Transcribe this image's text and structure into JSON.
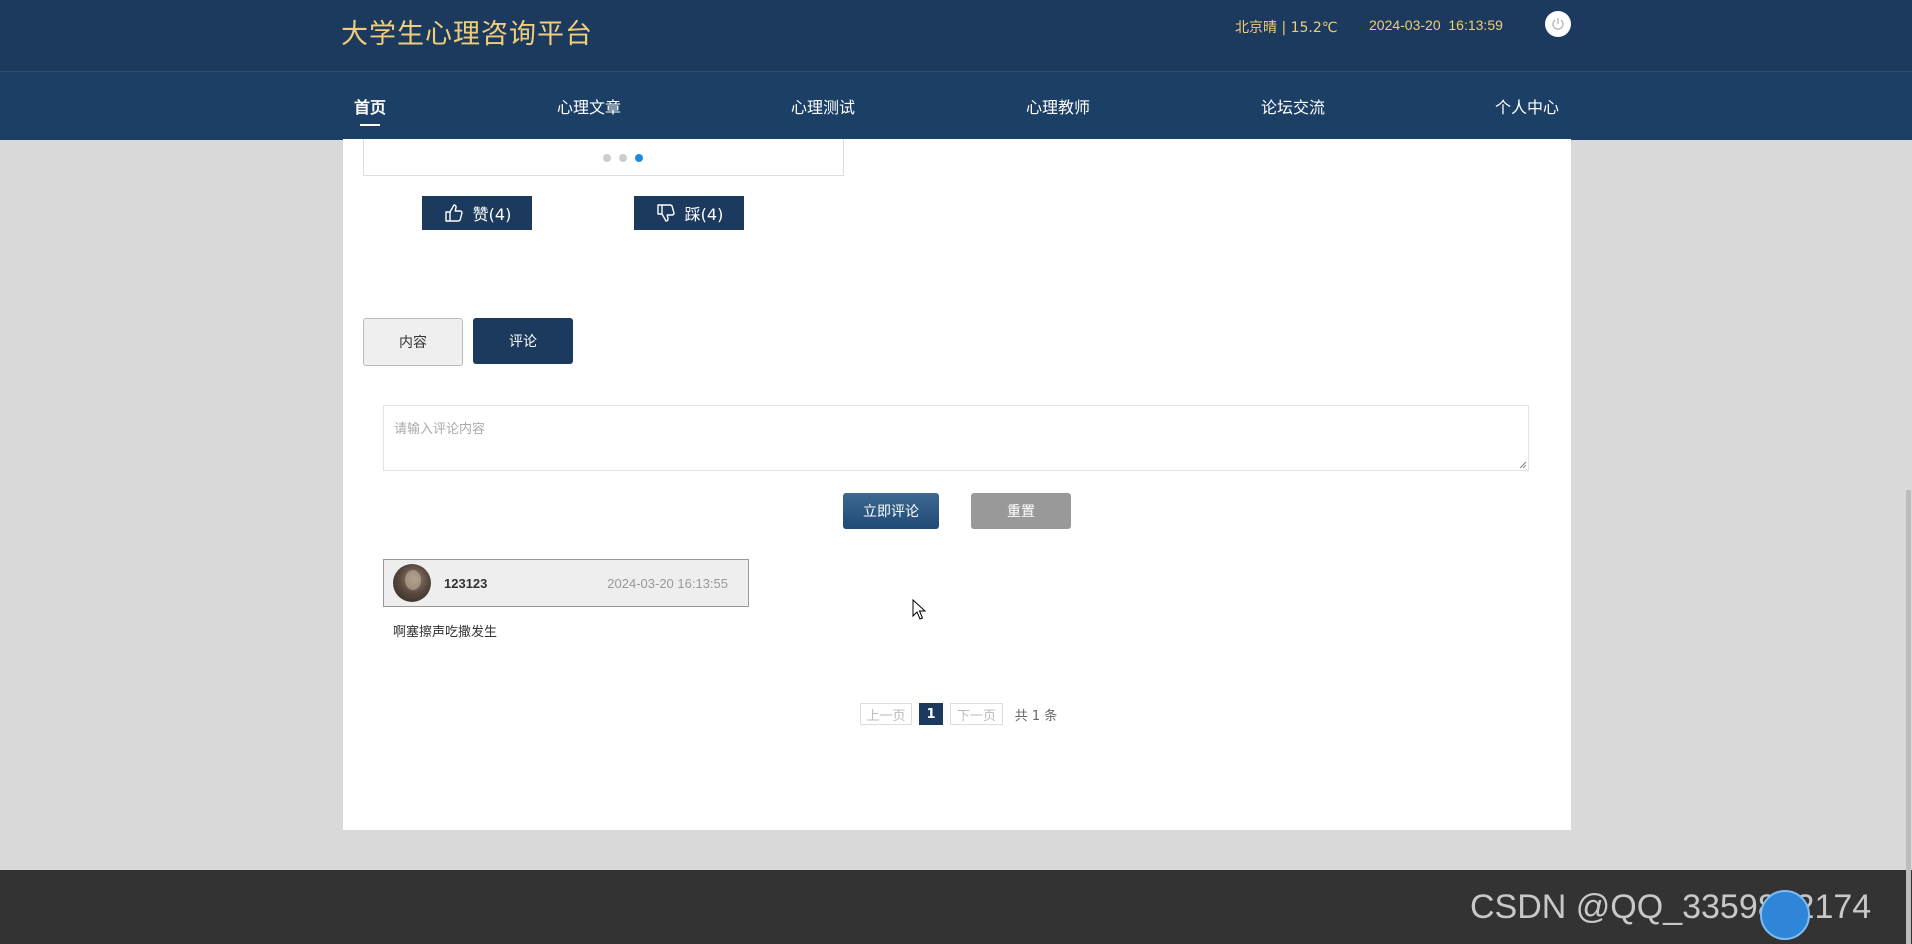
{
  "header": {
    "site_title": "大学生心理咨询平台",
    "weather": "北京晴 | 15.2℃",
    "datetime": "2024-03-20  16:13:59",
    "power_icon": "power-icon"
  },
  "nav": {
    "items": [
      {
        "label": "首页",
        "active": true
      },
      {
        "label": "心理文章"
      },
      {
        "label": "心理测试"
      },
      {
        "label": "心理教师"
      },
      {
        "label": "论坛交流"
      },
      {
        "label": "个人中心"
      }
    ]
  },
  "carousel": {
    "slide_count": 3,
    "active_index": 2
  },
  "votes": {
    "like_label": "赞(4)",
    "dislike_label": "踩(4)",
    "like_icon": "thumbs-up-icon",
    "dislike_icon": "thumbs-down-icon"
  },
  "tabs": {
    "content_label": "内容",
    "comment_label": "评论",
    "active": "评论"
  },
  "comment_form": {
    "placeholder": "请输入评论内容",
    "value": "",
    "submit_label": "立即评论",
    "reset_label": "重置"
  },
  "comments": [
    {
      "user": "123123",
      "time": "2024-03-20 16:13:55",
      "text": "啊塞擦声吃撒发生"
    }
  ],
  "pagination": {
    "prev_label": "上一页",
    "current_page": "1",
    "next_label": "下一页",
    "total_label": "共 1 条"
  },
  "watermark": "CSDN @QQ_3359892174",
  "colors": {
    "header_bg": "#1b3a5e",
    "nav_bg": "#1c3f66",
    "title_gold": "#f0cd7a",
    "page_bg": "#d9d9d9",
    "footer_bg": "#333333",
    "active_dot": "#1e88e5"
  }
}
